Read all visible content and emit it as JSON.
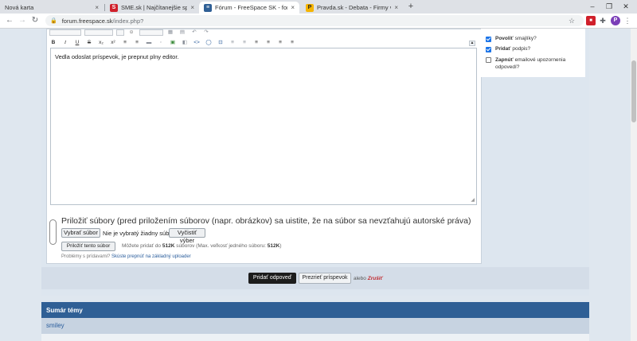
{
  "browser": {
    "tabs": [
      {
        "title": "Nová karta",
        "favicon": "",
        "active": false
      },
      {
        "title": "SME.sk | Najčítanejšie správy na S",
        "favicon": "S",
        "favicon_color": "#d0202b",
        "active": false
      },
      {
        "title": "Fórum - FreeSpace SK - forum.fre",
        "favicon": "≡",
        "favicon_color": "#2f5f95",
        "active": true
      },
      {
        "title": "Pravda.sk - Debata - Firmy vyzýva",
        "favicon": "P",
        "favicon_color": "#f5b400",
        "active": false
      }
    ],
    "tab_close": "×",
    "new_tab": "+",
    "window_controls": {
      "minimize": "–",
      "maximize": "❐",
      "close": "✕"
    },
    "url_host": "forum.freespace.sk",
    "url_path": "/index.php?",
    "toolbar_icons": {
      "star": "☆",
      "extension_red": "■",
      "puzzle": "✚",
      "avatar_letter": "P",
      "menu": "⋮"
    }
  },
  "editor": {
    "row2_buttons": [
      "B",
      "I",
      "U",
      "S",
      "x₂",
      "x²",
      "≡",
      "≡",
      "▬",
      "◦",
      "▣",
      "◧",
      "<>",
      "◯",
      "⊡",
      "≡",
      "≡",
      "≡",
      "≡",
      "≡",
      "≡"
    ],
    "content": "Vedla odoslat príspevok, je prepnut plny editor.",
    "toggle_icon": "▲",
    "resize_icon": "◢"
  },
  "options": {
    "items": [
      {
        "bold": "Povoliť",
        "rest": "smajlíky?",
        "checked": true
      },
      {
        "bold": "Pridať",
        "rest": "podpis?",
        "checked": true
      },
      {
        "bold": "Zapnúť",
        "rest": "emailové upozornenia odpovedí?",
        "checked": false
      }
    ]
  },
  "attachments": {
    "title": "Priložiť súbory (pred priložením súborov (napr. obrázkov) sa uistite, že na súbor sa nevzťahujú autorské práva)",
    "choose_file": "Vybrať súbor",
    "no_file": "Nie je vybratý žiadny súbor",
    "clear_selection": "Vyčistiť výber",
    "attach_this_file": "Priložiť tento súbor",
    "info_prefix": "Môžete pridať do",
    "info_total": "512K",
    "info_middle": "súborov  (Max. veľkosť jedného súboru:",
    "info_single": "512K",
    "info_suffix": ")",
    "trouble_text": "Problémy s prídavami?",
    "trouble_link": "Skúste prepnúť na základný uploader"
  },
  "actions": {
    "submit": "Pridať odpoveď",
    "preview": "Prezrieť príspevok",
    "or": "alebo",
    "cancel": "Zrušiť"
  },
  "summary": {
    "title": "Sumár témy",
    "row_label": "smiley"
  }
}
